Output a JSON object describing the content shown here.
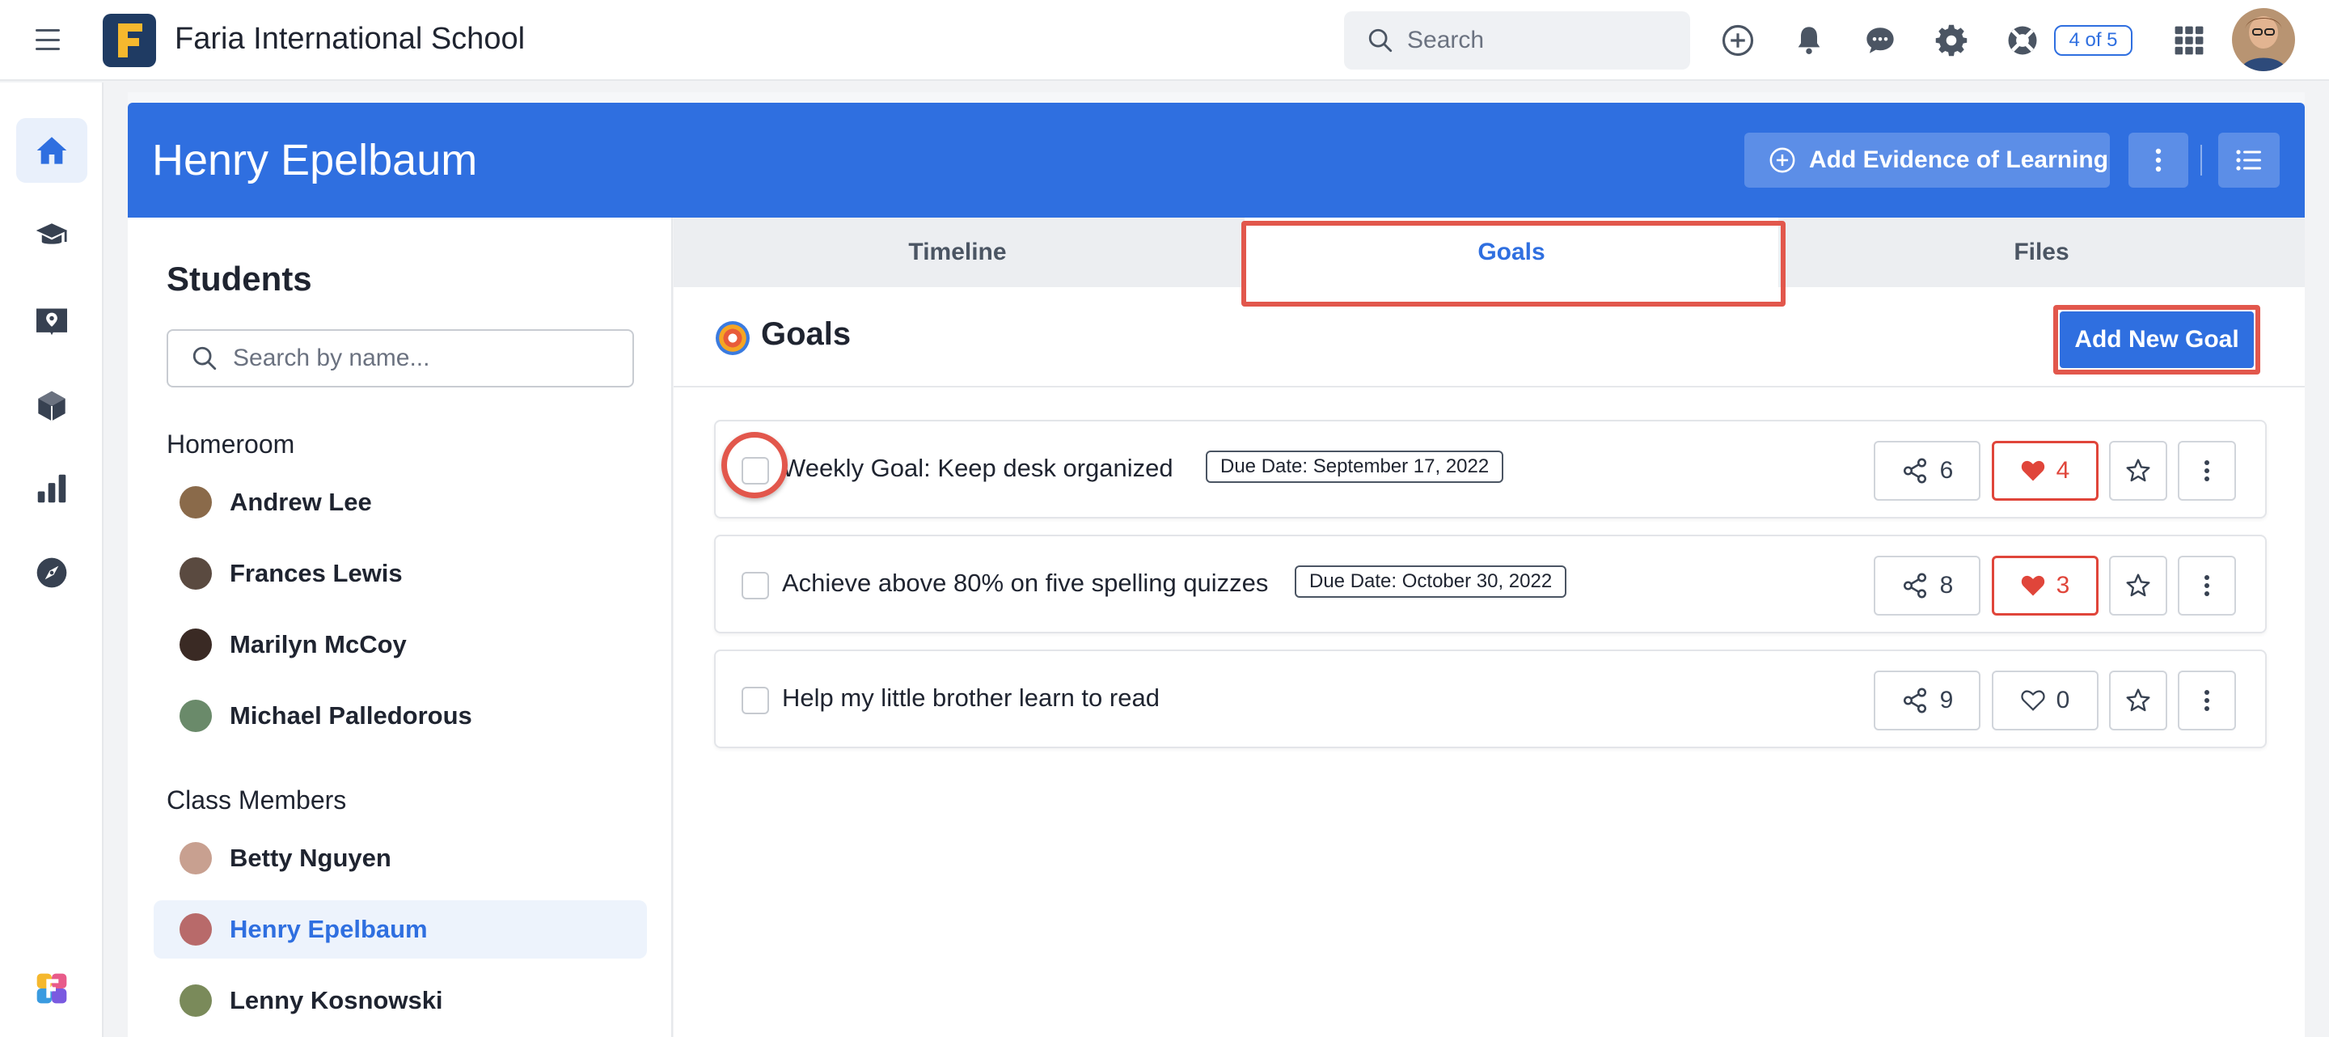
{
  "topbar": {
    "app_title": "Faria International School",
    "search_placeholder": "Search",
    "progress_badge": "4 of 5",
    "icons": [
      "menu-icon",
      "plus-circle-icon",
      "bell-icon",
      "chat-icon",
      "gear-icon",
      "lifebuoy-icon",
      "grid-icon"
    ]
  },
  "rail": {
    "icons": [
      "home-icon",
      "graduation-cap-icon",
      "map-book-icon",
      "cube-icon",
      "bar-chart-icon",
      "compass-icon",
      "faria-logo-icon"
    ]
  },
  "banner": {
    "student_name": "Henry Epelbaum",
    "add_evidence_label": "Add Evidence of Learning"
  },
  "students": {
    "title": "Students",
    "search_placeholder": "Search by name...",
    "homeroom_title": "Homeroom",
    "homeroom": [
      {
        "name": "Andrew Lee",
        "color": "#8a6a4a"
      },
      {
        "name": "Frances Lewis",
        "color": "#5a4a40"
      },
      {
        "name": "Marilyn McCoy",
        "color": "#3a2a24"
      },
      {
        "name": "Michael Palledorous",
        "color": "#6a8a6a"
      }
    ],
    "class_title": "Class Members",
    "class_members": [
      {
        "name": "Betty Nguyen",
        "color": "#c8a090"
      },
      {
        "name": "Henry Epelbaum",
        "color": "#b86a6a"
      },
      {
        "name": "Lenny Kosnowski",
        "color": "#7a8a5a"
      }
    ],
    "active_student": "Henry Epelbaum"
  },
  "tabs": {
    "items": [
      "Timeline",
      "Goals",
      "Files"
    ],
    "active": "Goals"
  },
  "goals": {
    "section_title": "Goals",
    "add_button": "Add New Goal",
    "items": [
      {
        "title": "Weekly Goal: Keep desk organized",
        "due": "Due Date: September 17, 2022",
        "shares": "6",
        "likes": "4",
        "liked": true
      },
      {
        "title": "Achieve above 80% on five spelling quizzes",
        "due": "Due Date: October 30, 2022",
        "shares": "8",
        "likes": "3",
        "liked": true
      },
      {
        "title": "Help my little brother learn to read",
        "due": "",
        "shares": "9",
        "likes": "0",
        "liked": false
      }
    ]
  },
  "colors": {
    "accent": "#2f6fe0",
    "highlight": "#e2574c",
    "like": "#e0453a"
  }
}
